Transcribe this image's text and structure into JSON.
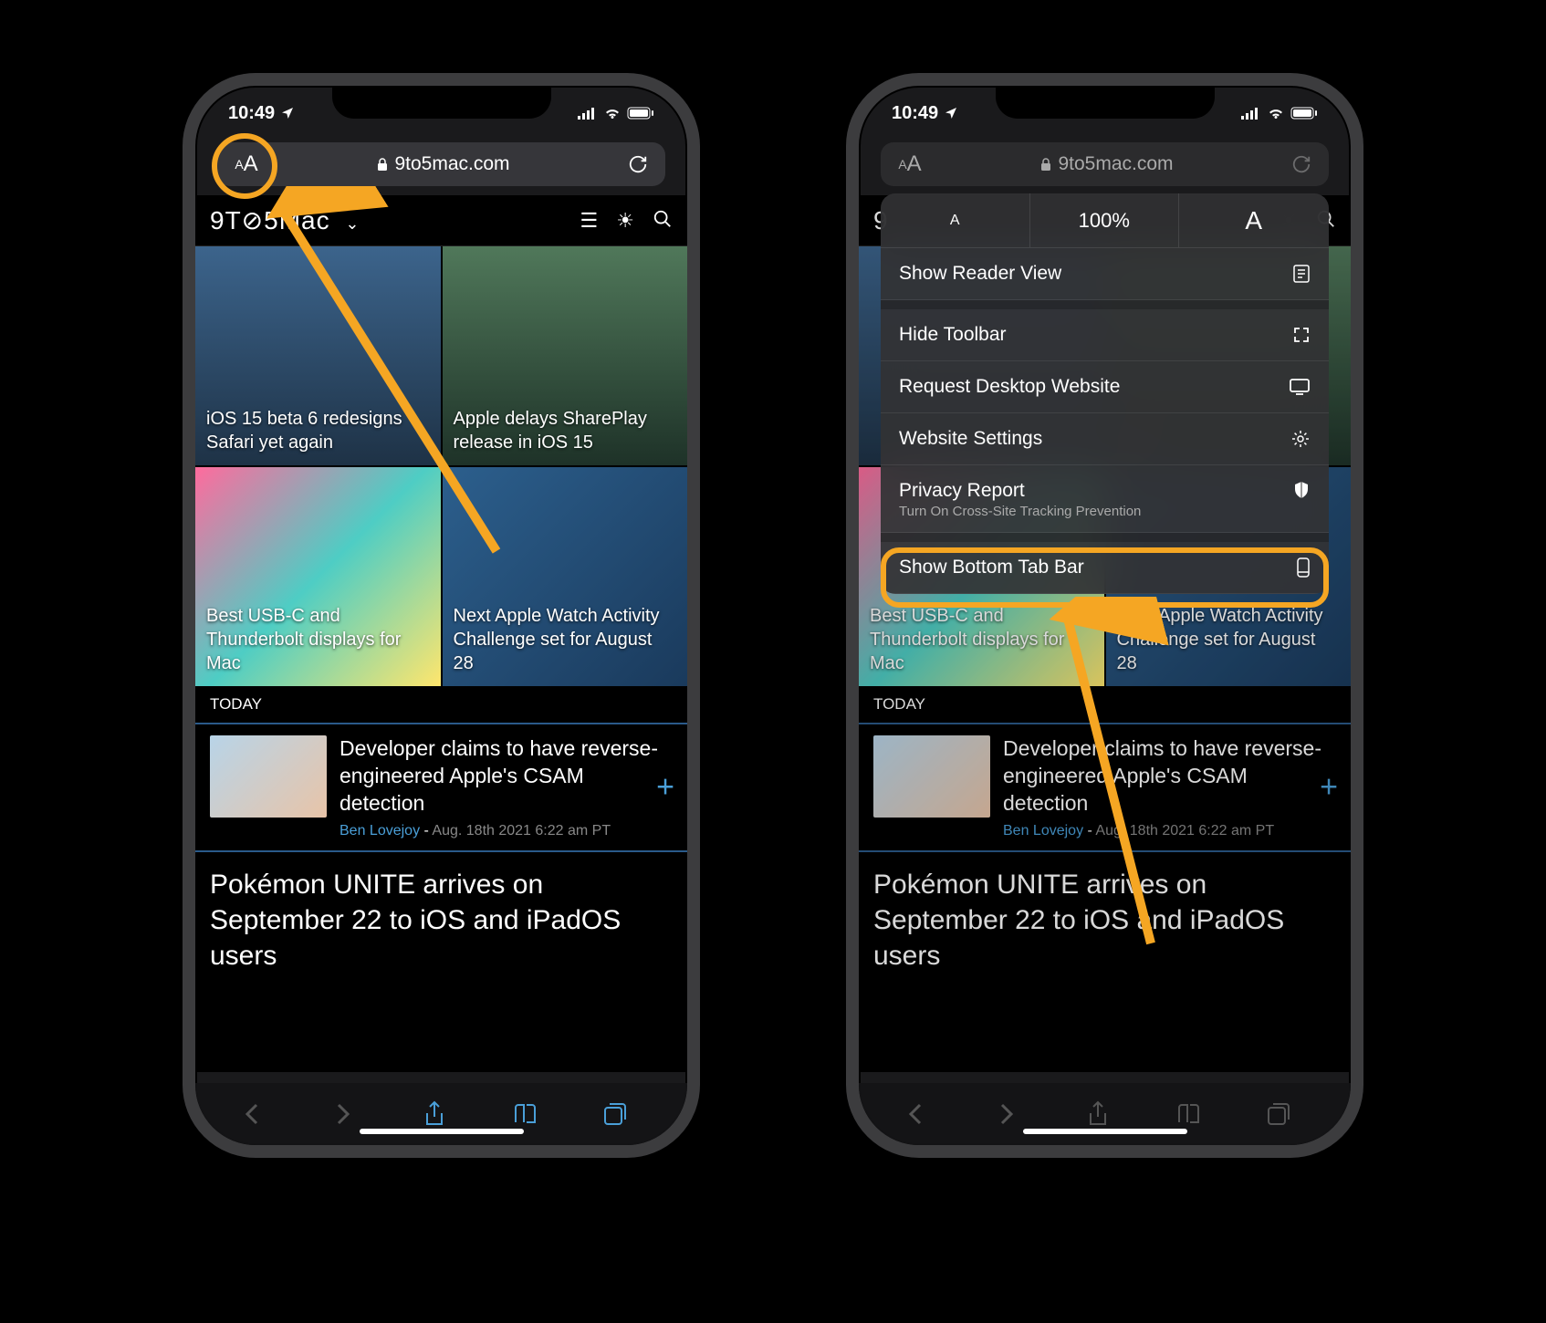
{
  "status": {
    "time": "10:49",
    "location_icon": "location-arrow",
    "signal_icon": "signal-bars",
    "wifi_icon": "wifi",
    "battery_icon": "battery-full"
  },
  "address": {
    "aa_label": "AA",
    "lock_icon": "lock",
    "url": "9to5mac.com",
    "reload_icon": "reload"
  },
  "site_header": {
    "logo": "9T⊘5Mac",
    "dropdown_icon": "chevron-down",
    "menu_icon": "hamburger",
    "theme_icon": "sun",
    "search_icon": "magnify"
  },
  "grid": [
    {
      "text": "iOS 15 beta 6 redesigns Safari yet again"
    },
    {
      "text": "Apple delays SharePlay release in iOS 15"
    },
    {
      "text": "Best USB-C and Thunderbolt displays for Mac"
    },
    {
      "text": "Next Apple Watch Activity Challenge set for August 28"
    }
  ],
  "section_label": "TODAY",
  "article": {
    "title": "Developer claims to have reverse-engineered Apple's CSAM detection",
    "author": "Ben Lovejoy",
    "date_separator": " - ",
    "date": "Aug. 18th 2021 6:22 am PT",
    "plus": "+"
  },
  "headline": "Pokémon UNITE arrives on September 22 to iOS and iPadOS users",
  "toolbar": {
    "back_icon": "chevron-left",
    "forward_icon": "chevron-right",
    "share_icon": "share",
    "bookmarks_icon": "book",
    "tabs_icon": "tabs"
  },
  "aa_menu": {
    "zoom_percent": "100%",
    "zoom_small": "A",
    "zoom_big": "A",
    "items": [
      {
        "label": "Show Reader View",
        "icon": "reader"
      },
      {
        "label": "Hide Toolbar",
        "icon": "expand"
      },
      {
        "label": "Request Desktop Website",
        "icon": "monitor"
      },
      {
        "label": "Website Settings",
        "icon": "gear"
      },
      {
        "label": "Privacy Report",
        "sub": "Turn On Cross-Site Tracking Prevention",
        "icon": "shield"
      },
      {
        "label": "Show Bottom Tab Bar",
        "icon": "phone-bottom"
      }
    ]
  },
  "annotations": {
    "accent": "#f5a623"
  }
}
